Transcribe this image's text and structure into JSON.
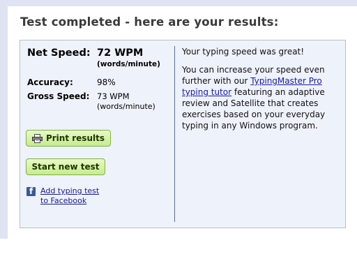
{
  "heading": "Test completed - here are your results:",
  "results": {
    "net_speed_label": "Net Speed:",
    "net_speed_value": "72 WPM",
    "net_speed_unit": "(words/minute)",
    "accuracy_label": "Accuracy:",
    "accuracy_value": "98%",
    "gross_speed_label": "Gross Speed:",
    "gross_speed_value": "73 WPM",
    "gross_speed_unit": "(words/minute)"
  },
  "buttons": {
    "print_label": "Print results",
    "new_test_label": "Start new test"
  },
  "facebook": {
    "line1": "Add typing test",
    "line2": "to Facebook"
  },
  "message": {
    "line1": "Your typing speed was great!",
    "p2_before": "You can increase your speed even further with our ",
    "p2_link": "TypingMaster Pro typing tutor",
    "p2_after": " featuring an adaptive review and Satellite that creates exercises based on your everyday typing in any Windows program."
  },
  "colors": {
    "button_green": "#c6ec8c",
    "panel_bg": "#eef2fa",
    "facebook_blue": "#3b5998",
    "link_blue": "#1a1aa8"
  }
}
